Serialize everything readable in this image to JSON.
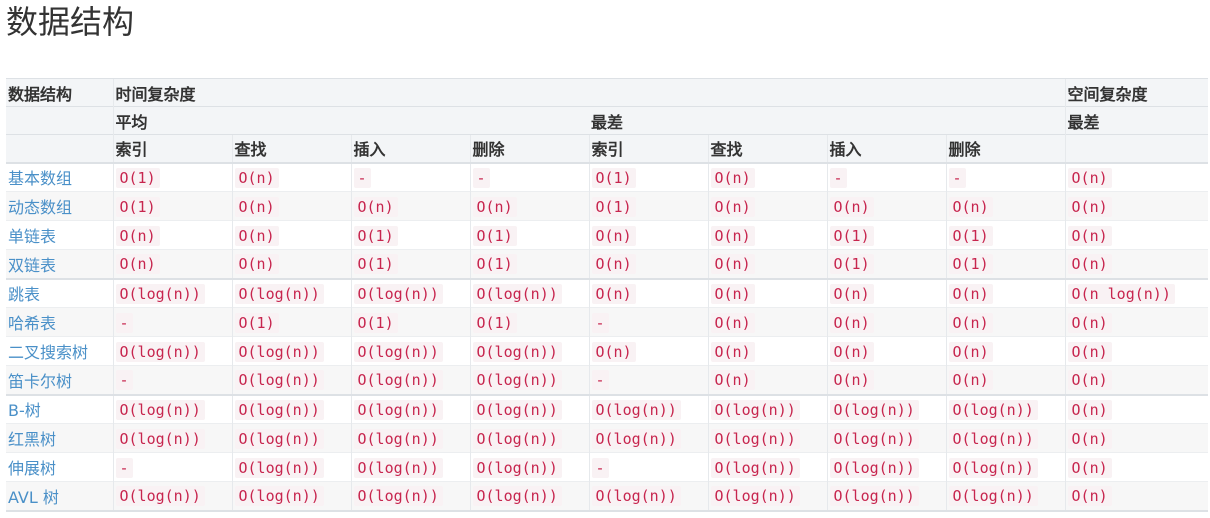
{
  "title": "数据结构",
  "header": {
    "col_name": "数据结构",
    "time_group": "时间复杂度",
    "space_group": "空间复杂度",
    "average": "平均",
    "worst": "最差",
    "space_worst": "最差",
    "ops": [
      "索引",
      "查找",
      "插入",
      "删除",
      "索引",
      "查找",
      "插入",
      "删除"
    ]
  },
  "rows": [
    {
      "name": "基本数组",
      "cells": [
        "O(1)",
        "O(n)",
        "-",
        "-",
        "O(1)",
        "O(n)",
        "-",
        "-",
        "O(n)"
      ]
    },
    {
      "name": "动态数组",
      "cells": [
        "O(1)",
        "O(n)",
        "O(n)",
        "O(n)",
        "O(1)",
        "O(n)",
        "O(n)",
        "O(n)",
        "O(n)"
      ]
    },
    {
      "name": "单链表",
      "cells": [
        "O(n)",
        "O(n)",
        "O(1)",
        "O(1)",
        "O(n)",
        "O(n)",
        "O(1)",
        "O(1)",
        "O(n)"
      ]
    },
    {
      "name": "双链表",
      "cells": [
        "O(n)",
        "O(n)",
        "O(1)",
        "O(1)",
        "O(n)",
        "O(n)",
        "O(1)",
        "O(1)",
        "O(n)"
      ]
    },
    {
      "name": "跳表",
      "cells": [
        "O(log(n))",
        "O(log(n))",
        "O(log(n))",
        "O(log(n))",
        "O(n)",
        "O(n)",
        "O(n)",
        "O(n)",
        "O(n log(n))"
      ]
    },
    {
      "name": "哈希表",
      "cells": [
        "-",
        "O(1)",
        "O(1)",
        "O(1)",
        "-",
        "O(n)",
        "O(n)",
        "O(n)",
        "O(n)"
      ]
    },
    {
      "name": "二叉搜索树",
      "cells": [
        "O(log(n))",
        "O(log(n))",
        "O(log(n))",
        "O(log(n))",
        "O(n)",
        "O(n)",
        "O(n)",
        "O(n)",
        "O(n)"
      ]
    },
    {
      "name": "笛卡尔树",
      "cells": [
        "-",
        "O(log(n))",
        "O(log(n))",
        "O(log(n))",
        "-",
        "O(n)",
        "O(n)",
        "O(n)",
        "O(n)"
      ]
    },
    {
      "name": "B-树",
      "cells": [
        "O(log(n))",
        "O(log(n))",
        "O(log(n))",
        "O(log(n))",
        "O(log(n))",
        "O(log(n))",
        "O(log(n))",
        "O(log(n))",
        "O(n)"
      ]
    },
    {
      "name": "红黑树",
      "cells": [
        "O(log(n))",
        "O(log(n))",
        "O(log(n))",
        "O(log(n))",
        "O(log(n))",
        "O(log(n))",
        "O(log(n))",
        "O(log(n))",
        "O(n)"
      ]
    },
    {
      "name": "伸展树",
      "cells": [
        "-",
        "O(log(n))",
        "O(log(n))",
        "O(log(n))",
        "-",
        "O(log(n))",
        "O(log(n))",
        "O(log(n))",
        "O(n)"
      ]
    },
    {
      "name": "AVL 树",
      "cells": [
        "O(log(n))",
        "O(log(n))",
        "O(log(n))",
        "O(log(n))",
        "O(log(n))",
        "O(log(n))",
        "O(log(n))",
        "O(log(n))",
        "O(n)"
      ]
    }
  ]
}
